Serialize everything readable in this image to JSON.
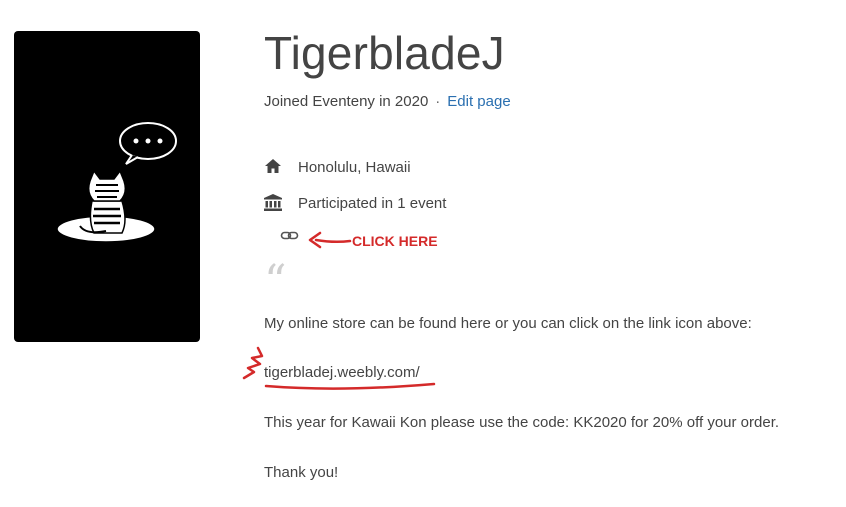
{
  "profile": {
    "name": "TigerbladeJ",
    "joined": "Joined Eventeny in 2020",
    "separator": "·",
    "edit_link": "Edit page"
  },
  "details": {
    "location": "Honolulu, Hawaii",
    "events": "Participated in 1 event"
  },
  "annotation": {
    "text": "CLICK HERE",
    "color": "#d42a2a"
  },
  "bio": {
    "quote_mark": "“",
    "line1": "My online store can be found here or you can click on the link icon above:",
    "url": "tigerbladej.weebly.com/",
    "line3": "This year for Kawaii Kon please use the code: KK2020 for 20% off your order.",
    "line4": "Thank you!"
  },
  "icons": {
    "location": "home-icon",
    "events": "institution-icon",
    "link": "link-icon",
    "avatar": "tiger-speech-bubble-illustration"
  },
  "colors": {
    "link": "#2a6fb0",
    "text": "#444444",
    "avatar_bg": "#000000"
  }
}
